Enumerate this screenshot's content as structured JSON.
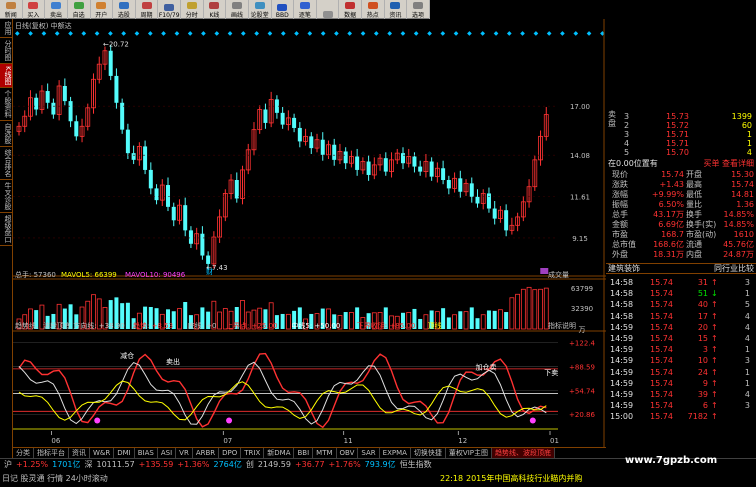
{
  "toolbar": {
    "buttons": [
      {
        "label": "新闻",
        "color": "#c08040"
      },
      {
        "label": "买入",
        "color": "#d04040"
      },
      {
        "label": "卖出",
        "color": "#4080d0"
      },
      {
        "label": "自选",
        "color": "#40a040"
      },
      {
        "label": "开户",
        "color": "#d08030"
      },
      {
        "label": "选股",
        "color": "#3070c0"
      },
      {
        "label": "周期",
        "color": "#c04040"
      },
      {
        "label": "F10/79",
        "color": "#4060a0"
      },
      {
        "label": "分时",
        "color": "#c0a030"
      },
      {
        "label": "K线",
        "color": "#b04040"
      },
      {
        "label": "画线",
        "color": "#808080"
      },
      {
        "label": "论股堂",
        "color": "#4090c0"
      },
      {
        "label": "BBD",
        "color": "#2050c0"
      },
      {
        "label": "逐笔",
        "color": "#3060d0"
      },
      {
        "label": "",
        "color": "#909090"
      },
      {
        "label": "数据",
        "color": "#c03030"
      },
      {
        "label": "热点",
        "color": "#d05020"
      },
      {
        "label": "资讯",
        "color": "#2060b0"
      },
      {
        "label": "选项",
        "color": "#808080"
      }
    ]
  },
  "left_tabs": [
    {
      "label": "应用",
      "active": false
    },
    {
      "label": "分时图",
      "active": false
    },
    {
      "label": "K线图",
      "active": true
    },
    {
      "label": "个股资料",
      "active": false
    },
    {
      "label": "自选股",
      "active": false
    },
    {
      "label": "综合排名",
      "active": false
    },
    {
      "label": "牛叉诊股",
      "active": false
    },
    {
      "label": "超级盘口",
      "active": false
    }
  ],
  "chart_title": "日线(复权)  中额达",
  "main_chart": {
    "price_labels": [
      {
        "text": "17.00",
        "price": 17.0
      },
      {
        "text": "14.08",
        "price": 14.08
      },
      {
        "text": "11.61",
        "price": 11.61
      },
      {
        "text": "9.15",
        "price": 9.15
      }
    ],
    "annotations": {
      "high": "←20.72",
      "low": "←7.43",
      "marker": "财",
      "marker2": "权"
    },
    "candles_x_domain": [
      0,
      110
    ]
  },
  "volume_panel": {
    "title": "总手: 57360",
    "mavol5": "MAVOL5: 66399",
    "mavol10": "MAVOL10: 90496",
    "button": "成交量",
    "labels": [
      {
        "text": "63799",
        "value": 63799
      },
      {
        "text": "32390",
        "value": 32390
      },
      {
        "text": "万",
        "value": 0
      }
    ]
  },
  "indicator_panel": {
    "title": "趋势线、波段顶底  方向线: +38.90",
    "items": [
      {
        "text": "趋势: +8.53",
        "color": "#ff3232"
      },
      {
        "text": "底线: +0",
        "color": "#c0c0c0"
      },
      {
        "text": "上界点: +25.00",
        "color": "#ff3232"
      },
      {
        "text": "中线5: +50.00",
        "color": "#ffffff"
      },
      {
        "text": "下界收阴: +85.00",
        "color": "#ff3232"
      },
      {
        "text": "顶线",
        "color": "#ffff00"
      }
    ],
    "button": "指标说明",
    "labels": [
      {
        "text": "+122.4",
        "value": 122.4
      },
      {
        "text": "+88.59",
        "value": 88.59
      },
      {
        "text": "+54.74",
        "value": 54.74
      },
      {
        "text": "+20.86",
        "value": 20.86
      }
    ],
    "annotations": [
      "减仓",
      "卖出",
      "加仓卖",
      "下卖"
    ]
  },
  "x_axis": [
    "06",
    "07",
    "11",
    "12",
    "01"
  ],
  "info_panel": {
    "title": "建筑装饰",
    "ask": [
      {
        "level": "3",
        "price": "15.73",
        "vol": "1399"
      },
      {
        "level": "2",
        "price": "15.72",
        "vol": "60"
      },
      {
        "level": "3",
        "price": "15.71",
        "vol": "1"
      },
      {
        "level": "4",
        "price": "15.71",
        "vol": "1"
      },
      {
        "level": "5",
        "price": "15.70",
        "vol": "4"
      }
    ],
    "ask_label": "卖盘",
    "bid_header": {
      "left": "在0.00位置有",
      "right": "买单 查看详细"
    },
    "stats": [
      {
        "l1": "现价",
        "v1": "15.74",
        "l2": "开盘",
        "v2": "15.30"
      },
      {
        "l1": "涨跌",
        "v1": "+1.43",
        "l2": "最高",
        "v2": "15.74"
      },
      {
        "l1": "涨幅",
        "v1": "+9.99%",
        "l2": "最低",
        "v2": "14.81"
      },
      {
        "l1": "振幅",
        "v1": "6.50%",
        "l2": "量比",
        "v2": "1.36"
      },
      {
        "l1": "总手",
        "v1": "43.17万",
        "l2": "换手",
        "v2": "14.85%"
      },
      {
        "l1": "金额",
        "v1": "6.69亿",
        "l2": "换手(实)",
        "v2": "14.85%"
      },
      {
        "l1": "市盈",
        "v1": "168.7",
        "l2": "市盈(动)",
        "v2": "1610"
      },
      {
        "l1": "总市值",
        "v1": "168.6亿",
        "l2": "流通",
        "v2": "45.76亿"
      },
      {
        "l1": "外盘",
        "v1": "18.31万",
        "l2": "内盘",
        "v2": "24.87万"
      }
    ],
    "trades_header": {
      "left": "建筑装饰",
      "right": "同行业比较"
    },
    "trades": [
      {
        "time": "14:58",
        "price": "15.74",
        "vol": "31",
        "dir": "up",
        "n": "3"
      },
      {
        "time": "14:58",
        "price": "15.74",
        "vol": "51",
        "dir": "down",
        "n": "1"
      },
      {
        "time": "14:58",
        "price": "15.74",
        "vol": "40",
        "dir": "up",
        "n": "5"
      },
      {
        "time": "14:58",
        "price": "15.74",
        "vol": "17",
        "dir": "up",
        "n": "4"
      },
      {
        "time": "14:59",
        "price": "15.74",
        "vol": "20",
        "dir": "up",
        "n": "4"
      },
      {
        "time": "14:59",
        "price": "15.74",
        "vol": "15",
        "dir": "up",
        "n": "4"
      },
      {
        "time": "14:59",
        "price": "15.74",
        "vol": "3",
        "dir": "up",
        "n": "1"
      },
      {
        "time": "14:59",
        "price": "15.74",
        "vol": "10",
        "dir": "up",
        "n": "3"
      },
      {
        "time": "14:59",
        "price": "15.74",
        "vol": "24",
        "dir": "up",
        "n": "1"
      },
      {
        "time": "14:59",
        "price": "15.74",
        "vol": "9",
        "dir": "up",
        "n": "1"
      },
      {
        "time": "14:59",
        "price": "15.74",
        "vol": "39",
        "dir": "up",
        "n": "4"
      },
      {
        "time": "14:59",
        "price": "15.74",
        "vol": "6",
        "dir": "up",
        "n": "3"
      },
      {
        "time": "15:00",
        "price": "15.74",
        "vol": "7182",
        "dir": "up",
        "n": ""
      }
    ]
  },
  "bottom_tabs": [
    {
      "label": "分类",
      "active": false
    },
    {
      "label": "指标平台",
      "active": false
    },
    {
      "label": "资讯",
      "active": false
    },
    {
      "label": "W&R",
      "active": false
    },
    {
      "label": "DMI",
      "active": false
    },
    {
      "label": "BIAS",
      "active": false
    },
    {
      "label": "ASI",
      "active": false
    },
    {
      "label": "VR",
      "active": false
    },
    {
      "label": "ARBR",
      "active": false
    },
    {
      "label": "DPO",
      "active": false
    },
    {
      "label": "TRIX",
      "active": false
    },
    {
      "label": "新DMA",
      "active": false
    },
    {
      "label": "BBI",
      "active": false
    },
    {
      "label": "MTM",
      "active": false
    },
    {
      "label": "OBV",
      "active": false
    },
    {
      "label": "SAR",
      "active": false
    },
    {
      "label": "EXPMA",
      "active": false
    },
    {
      "label": "切换快捷",
      "active": false
    },
    {
      "label": "董权VIP主图",
      "active": false
    },
    {
      "label": "趋势线、波段顶底",
      "active": true
    }
  ],
  "status_bar": {
    "items": [
      {
        "text": "沪",
        "color": "#c0c0c0"
      },
      {
        "text": "+1.25%",
        "color": "#ff3232"
      },
      {
        "text": "1701亿",
        "color": "#00c0ff"
      },
      {
        "text": "深",
        "color": "#c0c0c0"
      },
      {
        "text": "10111.57",
        "color": "#c0c0c0"
      },
      {
        "text": "+135.59",
        "color": "#ff3232"
      },
      {
        "text": "+1.36%",
        "color": "#ff3232"
      },
      {
        "text": "2764亿",
        "color": "#00c0ff"
      },
      {
        "text": "创",
        "color": "#c0c0c0"
      },
      {
        "text": "2149.59",
        "color": "#c0c0c0"
      },
      {
        "text": "+36.77",
        "color": "#ff3232"
      },
      {
        "text": "+1.76%",
        "color": "#ff3232"
      },
      {
        "text": "793.9亿",
        "color": "#00c0ff"
      },
      {
        "text": "恒生指数",
        "color": "#c0c0c0"
      }
    ]
  },
  "bottom_bar": {
    "left": "日记  股灵通  行情  24小时滚动",
    "time": "22:18",
    "news": "2015年中国高科技行业瞄内并购",
    "watermark": "www.7gpzb.com"
  }
}
